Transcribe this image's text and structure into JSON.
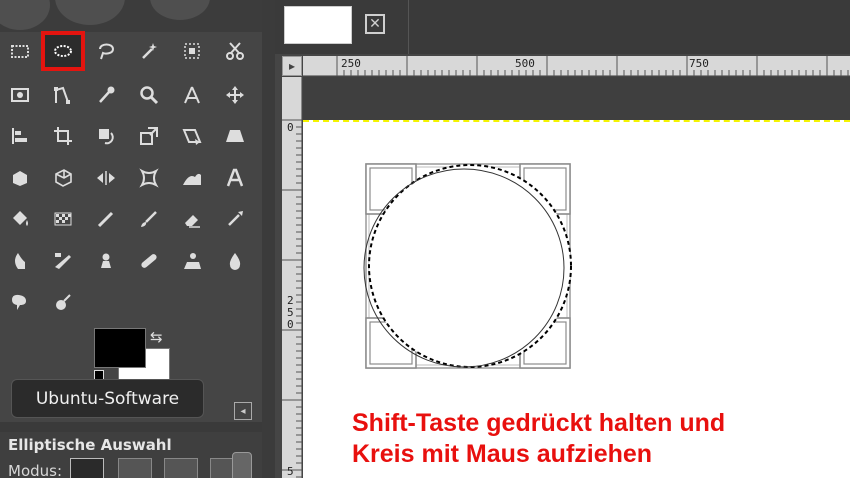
{
  "toolbox": {
    "tools": [
      [
        "rect-select-icon",
        "ellipse-select-icon",
        "free-select-icon",
        "fuzzy-select-icon",
        "select-by-color-icon",
        "scissors-select-icon"
      ],
      [
        "foreground-select-icon",
        "paths-icon",
        "color-picker-icon",
        "zoom-icon",
        "measure-icon",
        "move-icon"
      ],
      [
        "align-icon",
        "crop-icon",
        "rotate-icon",
        "scale-icon",
        "shear-icon",
        "perspective-icon"
      ],
      [
        "unified-transform-icon",
        "cage-transform-icon",
        "flip-icon",
        "warp-transform-icon",
        "handle-transform-icon",
        "text-icon"
      ],
      [
        "bucket-fill-icon",
        "blend-icon",
        "pencil-icon",
        "paintbrush-icon",
        "eraser-icon",
        "airbrush-icon"
      ],
      [
        "ink-icon",
        "mypaint-brush-icon",
        "clone-icon",
        "heal-icon",
        "perspective-clone-icon",
        "blur-sharpen-icon"
      ],
      [
        "smudge-icon",
        "dodge-burn-icon"
      ]
    ],
    "active_tool": "ellipse-select-icon",
    "colors": {
      "foreground": "#000000",
      "background": "#ffffff",
      "highlight": "#e4140f"
    },
    "tooltip": "Ubuntu-Software",
    "tool_options_title": "Elliptische Auswahl",
    "mode_label": "Modus:"
  },
  "image_window": {
    "ruler_ticks": [
      "250",
      "500",
      "750"
    ],
    "v_ruler_label": [
      "2",
      "5",
      "0"
    ],
    "v_ruler_zero": "0",
    "v_ruler_bottom": "5",
    "close_glyph": "✕"
  },
  "annotation": {
    "line1": "Shift-Taste gedrückt halten und",
    "line2": "Kreis mit Maus aufziehen",
    "color": "#e8100e"
  }
}
